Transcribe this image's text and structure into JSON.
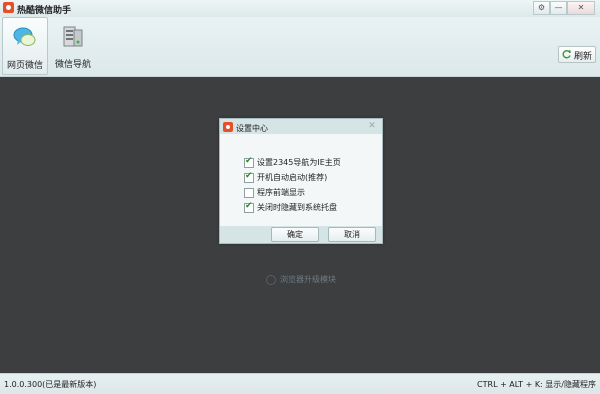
{
  "app": {
    "title": "热酷微信助手",
    "window_controls": [
      "⚙",
      "—",
      "✕"
    ]
  },
  "toolbar": {
    "items": [
      {
        "label": "网页微信",
        "icon": "chat-bubbles-icon",
        "selected": true
      },
      {
        "label": "微信导航",
        "icon": "server-icon",
        "selected": false
      }
    ],
    "refresh_label": "刷新"
  },
  "background": {
    "status_text": "浏览器升级模块"
  },
  "dialog": {
    "title": "设置中心",
    "close_icon": "✕",
    "options": [
      {
        "label": "设置2345导航为IE主页",
        "checked": true
      },
      {
        "label": "开机自动启动(推荐)",
        "checked": true
      },
      {
        "label": "程序前端显示",
        "checked": false
      },
      {
        "label": "关闭时隐藏到系统托盘",
        "checked": true
      }
    ],
    "ok_label": "确定",
    "cancel_label": "取消"
  },
  "statusbar": {
    "version": "1.0.0.300(已是最新版本)",
    "hotkey_hint": "CTRL + ALT + K: 显示/隐藏程序"
  },
  "colors": {
    "brand": "#e4502a",
    "content_bg": "#3c3e40",
    "check": "#2b8b2b"
  }
}
